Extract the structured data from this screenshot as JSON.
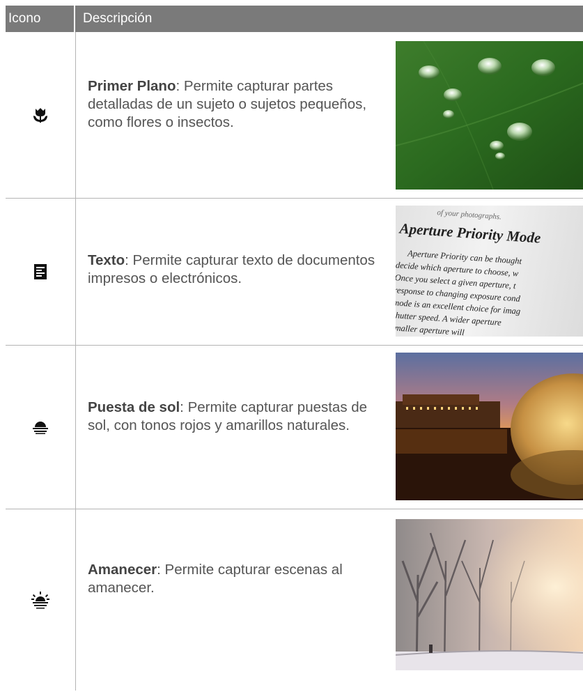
{
  "header": {
    "col_icon": "Icono",
    "col_desc": "Descripción"
  },
  "rows": [
    {
      "icon": "macro-flower-icon",
      "title": "Primer Plano",
      "desc": ": Permite capturar partes detalladas de un sujeto o sujetos pequeños, como flores o insectos.",
      "photo": "water-droplets-on-leaf-photo"
    },
    {
      "icon": "text-document-icon",
      "title": "Texto",
      "desc": ": Permite capturar texto de documentos impresos o electrónicos.",
      "photo": "printed-book-page-photo",
      "photo_text": {
        "caption": "of your photographs.",
        "heading": "Aperture Priority Mode",
        "lines": [
          "Aperture Priority can be thought",
          "decide which aperture to choose, w",
          "Once you select a given aperture, t",
          "response to changing exposure cond",
          "mode is an excellent choice for imag",
          "shutter speed. A wider aperture",
          "smaller aperture will"
        ]
      }
    },
    {
      "icon": "sunset-icon",
      "title": "Puesta de sol",
      "desc": ": Permite capturar puestas de sol, con tonos rojos y amarillos naturales.",
      "photo": "sunset-building-reflection-photo"
    },
    {
      "icon": "dawn-icon",
      "title": "Amanecer",
      "desc": ": Permite capturar escenas al amanecer.",
      "photo": "misty-dawn-trees-photo"
    }
  ],
  "colors": {
    "header_bg": "#7a7a7a",
    "rule": "#b4b4b4",
    "text": "#555555"
  }
}
